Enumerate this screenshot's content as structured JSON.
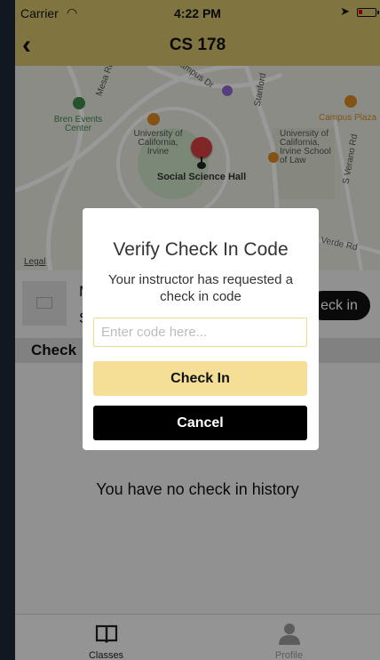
{
  "status_bar": {
    "carrier": "Carrier",
    "time": "4:22 PM"
  },
  "nav": {
    "title": "CS 178"
  },
  "map": {
    "labels": {
      "bren": "Bren Events Center",
      "university_left": "University of California, Irvine",
      "social_science": "Social Science Hall",
      "university_right": "University of California, Irvine School of Law",
      "campus_plaza": "Campus Plaza",
      "campus_dr": "Campus Dr",
      "mesa_rd": "Mesa Rd",
      "stanford": "Stanford",
      "s_verano_rd": "S Verano Rd",
      "verde_rd": "Verde Rd",
      "legal": "Legal"
    }
  },
  "class_info": {
    "name_initial": "M",
    "sub_initial": "S",
    "checkin_label": "eck in"
  },
  "history": {
    "header": "Check",
    "empty_message": "You have no check in history"
  },
  "tabs": [
    {
      "label": "Classes"
    },
    {
      "label": "Profile"
    }
  ],
  "modal": {
    "title": "Verify Check In Code",
    "message": "Your instructor has requested a check in code",
    "input_placeholder": "Enter code here...",
    "input_value": "",
    "checkin_label": "Check In",
    "cancel_label": "Cancel"
  },
  "colors": {
    "accent": "#d6c36b",
    "button_yellow": "#f5df96",
    "cancel_black": "#000000",
    "backdrop": "#1f2837"
  }
}
